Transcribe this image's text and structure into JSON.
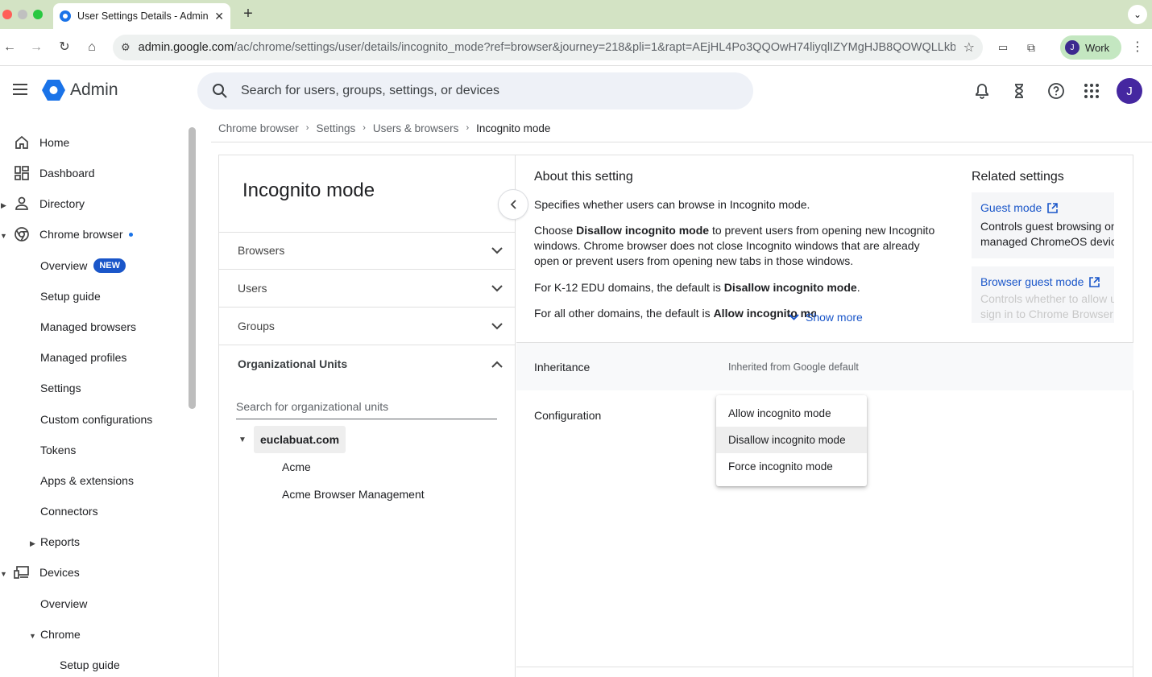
{
  "browser": {
    "tab_title": "User Settings Details - Admin Console",
    "url_host": "admin.google.com",
    "url_path": "/ac/chrome/settings/user/details/incognito_mode?ref=browser&journey=218&pli=1&rapt=AEjHL4Po3QQOwH74liyqlIZYMgHJB8QOWQLLkb...",
    "profile_label": "Work",
    "profile_initial": "J"
  },
  "header": {
    "product": "Admin",
    "search_placeholder": "Search for users, groups, settings, or devices",
    "avatar_initial": "J"
  },
  "sidebar": {
    "items": [
      {
        "label": "Home"
      },
      {
        "label": "Dashboard"
      },
      {
        "label": "Directory"
      },
      {
        "label": "Chrome browser"
      },
      {
        "label": "Overview",
        "badge": "NEW"
      },
      {
        "label": "Setup guide"
      },
      {
        "label": "Managed browsers"
      },
      {
        "label": "Managed profiles"
      },
      {
        "label": "Settings"
      },
      {
        "label": "Custom configurations"
      },
      {
        "label": "Tokens"
      },
      {
        "label": "Apps & extensions"
      },
      {
        "label": "Connectors"
      },
      {
        "label": "Reports"
      },
      {
        "label": "Devices"
      },
      {
        "label": "Overview"
      },
      {
        "label": "Chrome"
      },
      {
        "label": "Setup guide"
      }
    ]
  },
  "breadcrumb": [
    "Chrome browser",
    "Settings",
    "Users & browsers",
    "Incognito mode"
  ],
  "leftpane": {
    "title": "Incognito mode",
    "sections": [
      "Browsers",
      "Users",
      "Groups",
      "Organizational Units"
    ],
    "ou_search_placeholder": "Search for organizational units",
    "tree_root": "euclabuat.com",
    "tree_children": [
      "Acme",
      "Acme Browser Management"
    ]
  },
  "about": {
    "title": "About this setting",
    "p1": "Specifies whether users can browse in Incognito mode.",
    "p2_pre": "Choose ",
    "p2_bold": "Disallow incognito mode",
    "p2_post": " to prevent users from opening new Incognito windows. Chrome browser does not close Incognito windows that are already open or prevent users from opening new tabs in those windows.",
    "p3_pre": "For K-12 EDU domains, the default is ",
    "p3_bold": "Disallow incognito mode",
    "p3_post": ".",
    "p4_pre": "For all other domains, the default is ",
    "p4_bold": "Allow incognito mode",
    "p4_post": ".",
    "show_more": "Show more"
  },
  "related": {
    "title": "Related settings",
    "items": [
      {
        "link": "Guest mode",
        "desc_l1": "Controls guest browsing on",
        "desc_l2": "managed ChromeOS devices"
      },
      {
        "link": "Browser guest mode",
        "desc_l1": "Controls whether to allow users to",
        "desc_l2": "sign in to Chrome Browser as guests"
      }
    ]
  },
  "inheritance": {
    "label": "Inheritance",
    "value": "Inherited from Google default"
  },
  "configuration": {
    "label": "Configuration",
    "options": [
      "Allow incognito mode",
      "Disallow incognito mode",
      "Force incognito mode"
    ]
  }
}
